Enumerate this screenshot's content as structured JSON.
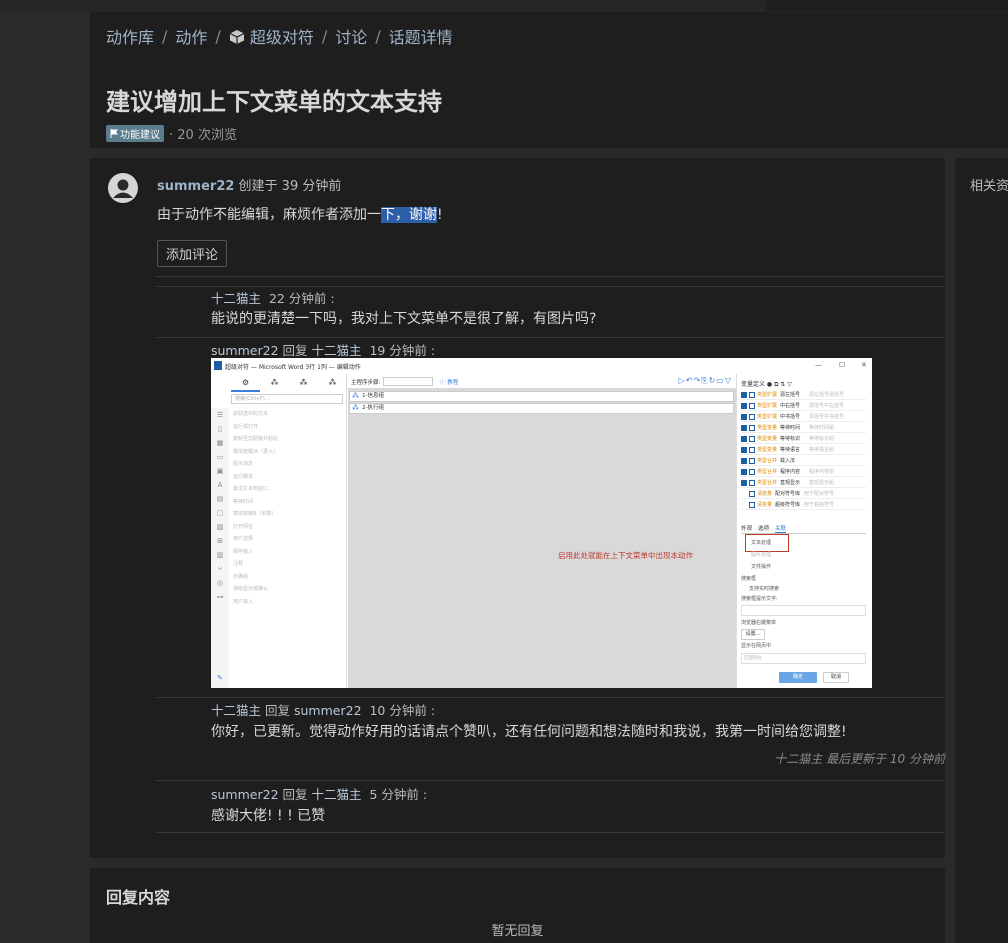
{
  "breadcrumb": {
    "items": [
      "动作库",
      "动作",
      "超级对符",
      "讨论",
      "话题详情"
    ]
  },
  "page": {
    "title": "建议增加上下文菜单的文本支持",
    "tag": "功能建议",
    "views": "· 20 次浏览"
  },
  "sidebar": {
    "title": "相关资"
  },
  "post": {
    "author": "summer22",
    "created": "创建于 39 分钟前",
    "body_before": "由于动作不能编辑，麻烦作者添加一",
    "body_highlight": "下，谢谢",
    "body_after": "!",
    "add_comment_label": "添加评论"
  },
  "comments": [
    {
      "author": "十二猫主",
      "reply_to": "",
      "time": "22 分钟前 :",
      "text": "能说的更清楚一下吗，我对上下文菜单不是很了解，有图片吗?"
    },
    {
      "author": "summer22",
      "reply_to": "十二猫主",
      "time": "19 分钟前 :",
      "text": ""
    },
    {
      "author": "十二猫主",
      "reply_to": "summer22",
      "time": "10 分钟前 :",
      "text": "你好，已更新。觉得动作好用的话请点个赞叭，还有任何问题和想法随时和我说，我第一时间给您调整!"
    },
    {
      "author": "summer22",
      "reply_to": "十二猫主",
      "time": "5 分钟前 :",
      "text": "感谢大佬! ! ! 已赞"
    }
  ],
  "reply_word": "回复",
  "edited_note": "十二猫主 最后更新于 10 分钟前",
  "reply_section": {
    "title": "回复内容",
    "empty": "暂无回复"
  },
  "screenshot": {
    "window_title": "超级对符 — Microsoft Word 3行 1列 — 编辑动作",
    "window_controls": [
      "—",
      "☐",
      "✕"
    ],
    "search_placeholder": "搜索(Ctrl+F)...",
    "left_items": [
      "获取选中的文本",
      "运行或打开",
      "复制至剪贴板并粘贴",
      "模拟按键/A（录入）",
      "提示消息",
      "运行脚本",
      "激活文本到窗口",
      "等待时间",
      "模拟按键B（单数）",
      "打开网址",
      "用户选择",
      "保存输入",
      "注释",
      "步骤组",
      "弹窗显示或确认",
      "用户输入"
    ],
    "sequence_label": "主程序步骤:",
    "help_label": "教程",
    "steps": [
      "1-信息组",
      "2-执行组"
    ],
    "hint": "启用此处就能在上下文菜单中出现本动作",
    "variables_label": "变量定义",
    "variables": [
      {
        "cat": "类型扩展",
        "name": "源左括号",
        "desc": "源左括号源括号"
      },
      {
        "cat": "类型扩展",
        "name": "中右括号",
        "desc": "源括号中右括号"
      },
      {
        "cat": "类型扩展",
        "name": "中书括号",
        "desc": "源括号中书括号"
      },
      {
        "cat": "类型变量",
        "name": "等待时间",
        "desc": "等待时间组"
      },
      {
        "cat": "类型变量",
        "name": "等待标识",
        "desc": "等待标识组"
      },
      {
        "cat": "类型变量",
        "name": "等待语言",
        "desc": "等待语言组"
      },
      {
        "cat": "类型合并",
        "name": "载入法",
        "desc": ""
      },
      {
        "cat": "类型合并",
        "name": "程序内容",
        "desc": "程序内容组"
      },
      {
        "cat": "类型合并",
        "name": "直观显示",
        "desc": "直观显示组"
      },
      {
        "cat": "请变量",
        "name": "配对符号库",
        "desc": "用于配对符号"
      },
      {
        "cat": "请变量",
        "name": "超级符号库",
        "desc": "用于超级符号"
      }
    ],
    "tabs": [
      "外观",
      "选项",
      "关联"
    ],
    "assoc_items": [
      "文本处理",
      "图片处理",
      "文件操作"
    ],
    "search_box_label": "搜索框",
    "search_box_opt": "支持实时搜索",
    "search_hint_label": "搜索框提示文字:",
    "context_menu_label": "浏览器右键菜单",
    "settings_btn": "设置...",
    "show_in_page": "显示在网页中",
    "show_placeholder": "匹配网址",
    "ok": "确定",
    "cancel": "取消"
  }
}
